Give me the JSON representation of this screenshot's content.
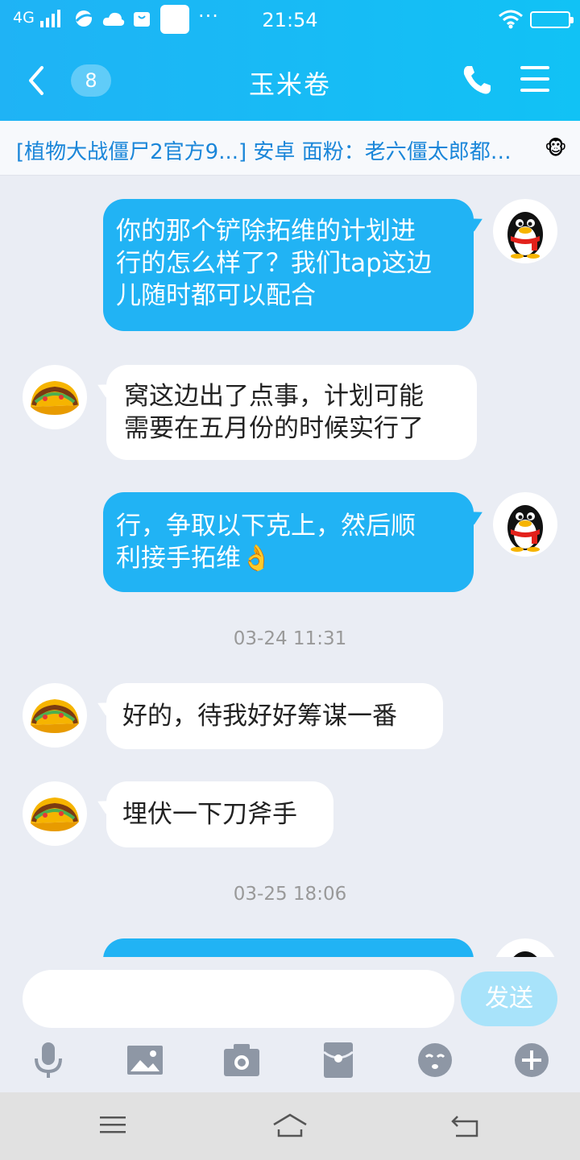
{
  "status_bar": {
    "network": "4G",
    "time": "21:54",
    "more": "···"
  },
  "header": {
    "back_icon": "chevron-left-icon",
    "unread_count": "8",
    "title": "玉米卷",
    "call_icon": "phone-icon",
    "menu_icon": "menu-icon"
  },
  "notice": {
    "text": "[植物大战僵尸2官方9...] 安卓 面粉：老六僵太郎都…",
    "emoji": "🐵"
  },
  "messages": [
    {
      "side": "out",
      "lines": [
        "你的那个铲除拓维的计划进",
        "行的怎么样了？我们tap这边",
        "儿随时都可以配合"
      ]
    },
    {
      "side": "in",
      "lines": [
        "窝这边出了点事，计划可能",
        "需要在五月份的时候实行了"
      ]
    },
    {
      "side": "out",
      "lines": [
        "行，争取以下克上，然后顺",
        "利接手拓维👌"
      ]
    },
    {
      "timestamp": "03-24 11:31"
    },
    {
      "side": "in",
      "lines": [
        "好的，待我好好筹谋一番"
      ]
    },
    {
      "side": "in",
      "lines": [
        "埋伏一下刀斧手"
      ]
    },
    {
      "timestamp": "03-25 18:06"
    }
  ],
  "composer": {
    "input_value": "",
    "send_label": "发送"
  },
  "toolbar_icons": [
    "microphone-icon",
    "image-icon",
    "camera-icon",
    "red-packet-icon",
    "emoji-icon",
    "plus-icon"
  ],
  "colors": {
    "header": "#1fb3f5",
    "outgoing_bubble": "#21b3f4",
    "incoming_bubble": "#ffffff",
    "background": "#eaedf4",
    "notice_text": "#1a86d9"
  }
}
